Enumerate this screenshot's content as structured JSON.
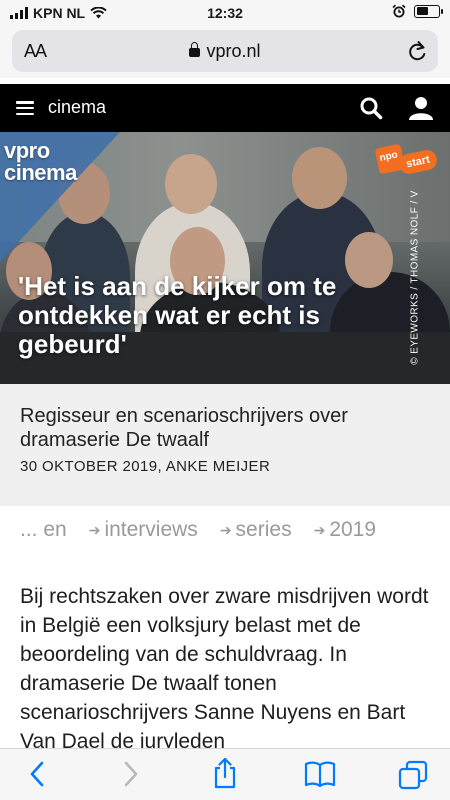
{
  "status": {
    "carrier": "KPN NL",
    "time": "12:32"
  },
  "browser": {
    "aa_label": "AA",
    "url": "vpro.nl"
  },
  "site": {
    "section": "cinema"
  },
  "hero": {
    "logo_line1": "vpro",
    "logo_line2": "cinema",
    "badge_text": "start",
    "badge_npo": "npo",
    "credit": "© EYEWORKS / THOMAS NOLF / V",
    "headline": "'Het is aan de kijker om te ontdekken wat er echt is gebeurd'"
  },
  "article": {
    "subtitle": "Regisseur en scenarioschrijvers over dramaserie De twaalf",
    "meta": "30 OKTOBER 2019, ANKE MEIJER",
    "tags": [
      "... en",
      "interviews",
      "series",
      "2019"
    ],
    "body": "Bij rechtszaken over zware misdrijven wordt in België een volksjury belast met de beoordeling van de schuldvraag. In dramaserie De twaalf tonen scenarioschrijvers Sanne Nuyens en Bart Van Dael de juryleden"
  },
  "colors": {
    "accent": "#f36e21",
    "ios_blue": "#007aff",
    "nav_bg": "#000000"
  }
}
